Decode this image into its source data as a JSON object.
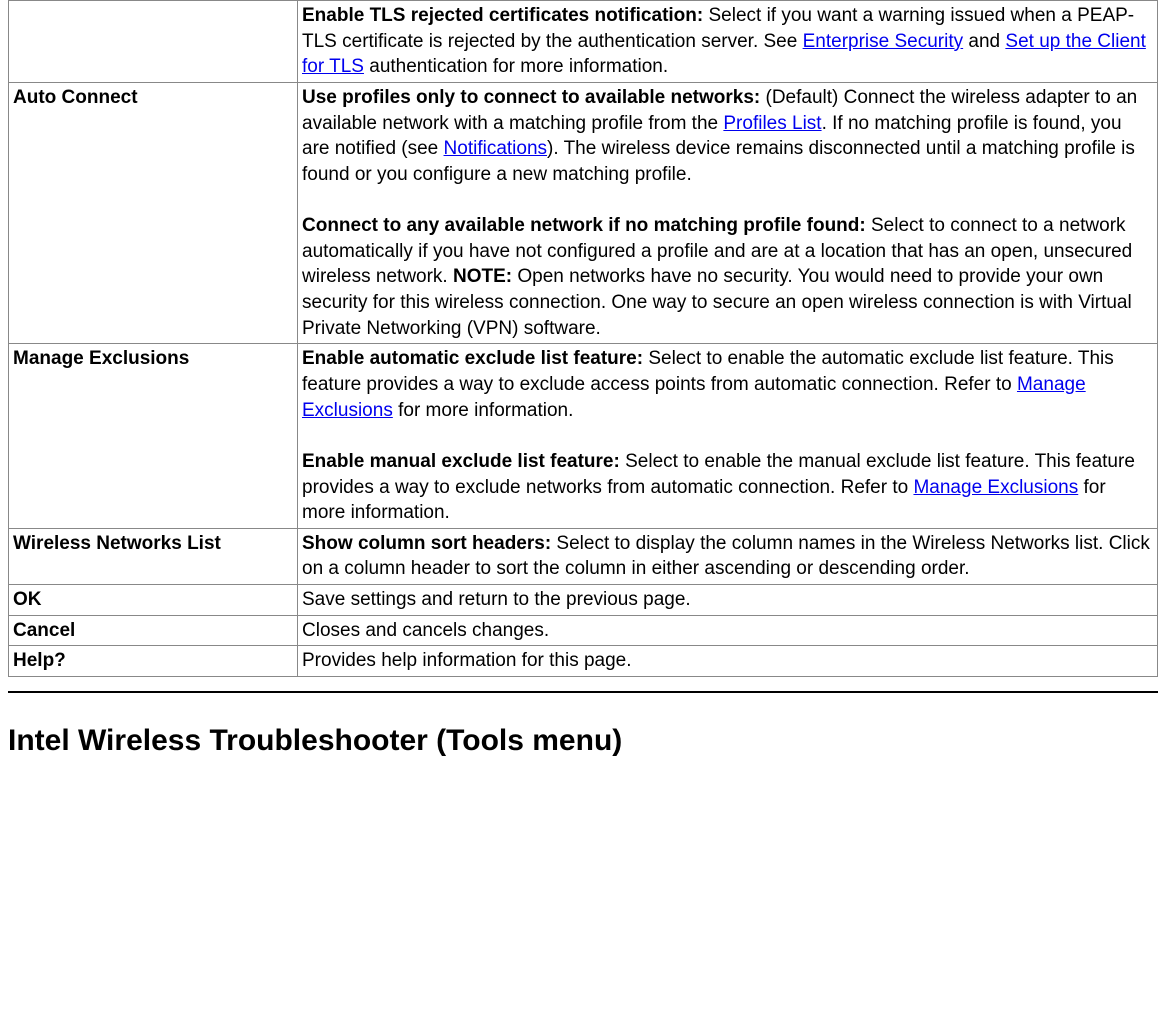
{
  "rows": [
    {
      "label": "",
      "content": [
        {
          "kind": "bold",
          "text": "Enable TLS rejected certificates notification:"
        },
        {
          "kind": "text",
          "text": " Select if you want a warning issued when a PEAP-TLS certificate is rejected by the authentication server. See "
        },
        {
          "kind": "link",
          "text": "Enterprise Security"
        },
        {
          "kind": "text",
          "text": " and "
        },
        {
          "kind": "link",
          "text": "Set up the Client for TLS"
        },
        {
          "kind": "text",
          "text": " authentication for more information."
        }
      ]
    },
    {
      "label": "Auto Connect",
      "content": [
        {
          "kind": "bold",
          "text": "Use profiles only to connect to available networks:"
        },
        {
          "kind": "text",
          "text": " (Default) Connect the wireless adapter to an available network with a matching profile from the "
        },
        {
          "kind": "link",
          "text": "Profiles List"
        },
        {
          "kind": "text",
          "text": ". If no matching profile is found, you are notified (see "
        },
        {
          "kind": "link",
          "text": "Notifications"
        },
        {
          "kind": "text",
          "text": "). The wireless device remains disconnected until a matching profile is found or you configure a new matching profile."
        },
        {
          "kind": "br"
        },
        {
          "kind": "br"
        },
        {
          "kind": "bold",
          "text": "Connect to any available network if no matching profile found:"
        },
        {
          "kind": "text",
          "text": " Select to connect to a network automatically if you have not configured a profile and are at a location that has an open, unsecured wireless network. "
        },
        {
          "kind": "bold",
          "text": "NOTE:"
        },
        {
          "kind": "text",
          "text": " Open networks have no security. You would need to provide your own security for this wireless connection. One way to secure an open wireless connection is with Virtual Private Networking (VPN) software."
        }
      ]
    },
    {
      "label": "Manage Exclusions",
      "content": [
        {
          "kind": "bold",
          "text": "Enable automatic exclude list feature:"
        },
        {
          "kind": "text",
          "text": " Select to enable the automatic exclude list feature. This feature provides a way to exclude access points from automatic connection. Refer to "
        },
        {
          "kind": "link",
          "text": "Manage Exclusions"
        },
        {
          "kind": "text",
          "text": " for more information."
        },
        {
          "kind": "br"
        },
        {
          "kind": "br"
        },
        {
          "kind": "bold",
          "text": "Enable manual exclude list feature:"
        },
        {
          "kind": "text",
          "text": " Select to enable the manual exclude list feature. This feature provides a way to exclude networks from automatic connection. Refer to "
        },
        {
          "kind": "link",
          "text": "Manage Exclusions"
        },
        {
          "kind": "text",
          "text": " for more information."
        }
      ]
    },
    {
      "label": "Wireless Networks List",
      "content": [
        {
          "kind": "bold",
          "text": "Show column sort headers:"
        },
        {
          "kind": "text",
          "text": " Select to display the column names in the Wireless Networks list. Click on a column header to sort the column in either ascending or descending order."
        }
      ]
    },
    {
      "label": "OK",
      "content": [
        {
          "kind": "text",
          "text": "Save settings and return to the previous page."
        }
      ]
    },
    {
      "label": "Cancel",
      "content": [
        {
          "kind": "text",
          "text": "Closes and cancels changes."
        }
      ]
    },
    {
      "label": "Help?",
      "content": [
        {
          "kind": "text",
          "text": "Provides help information for this page."
        }
      ]
    }
  ],
  "heading": "Intel Wireless Troubleshooter (Tools menu)"
}
